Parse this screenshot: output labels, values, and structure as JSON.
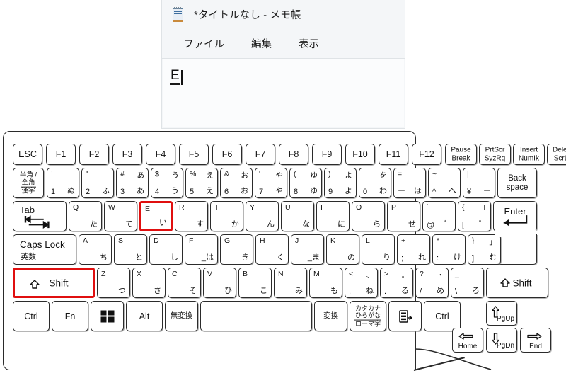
{
  "notepad": {
    "title": "*タイトルなし - メモ帳",
    "icon": "notepad-icon",
    "menus": [
      "ファイル",
      "編集",
      "表示"
    ],
    "document": {
      "composed_text": "E",
      "has_ime_underline": true,
      "caret_visible": true
    }
  },
  "keyboard": {
    "layout": "JIS Japanese 106-key (laptop)",
    "highlight_color": "#e00f0f",
    "highlighted_keys": [
      "E",
      "Shift-left"
    ],
    "rows": {
      "function_row": [
        {
          "name": "escape",
          "label": "ESC"
        },
        {
          "name": "f1",
          "label": "F1"
        },
        {
          "name": "f2",
          "label": "F2"
        },
        {
          "name": "f3",
          "label": "F3"
        },
        {
          "name": "f4",
          "label": "F4"
        },
        {
          "name": "f5",
          "label": "F5"
        },
        {
          "name": "f6",
          "label": "F6"
        },
        {
          "name": "f7",
          "label": "F7"
        },
        {
          "name": "f8",
          "label": "F8"
        },
        {
          "name": "f9",
          "label": "F9"
        },
        {
          "name": "f10",
          "label": "F10"
        },
        {
          "name": "f11",
          "label": "F11"
        },
        {
          "name": "f12",
          "label": "F12"
        },
        {
          "name": "pause-break",
          "line1": "Pause",
          "line2": "Break"
        },
        {
          "name": "print-screen",
          "line1": "PrtScr",
          "line2": "SyzRq"
        },
        {
          "name": "insert-numlk",
          "line1": "Insert",
          "line2": "NumIk"
        },
        {
          "name": "delete-scrlk",
          "line1": "Delete",
          "line2": "ScrLk"
        }
      ],
      "number_row": [
        {
          "name": "hankaku-zenkaku",
          "l1": "半角 /",
          "l2": "全角",
          "l3": "漢字"
        },
        {
          "name": "digit-1",
          "tl": "!",
          "bl": "1",
          "br": "ぬ"
        },
        {
          "name": "digit-2",
          "tl": "\"",
          "bl": "2",
          "br": "ふ"
        },
        {
          "name": "digit-3",
          "tl": "#",
          "tr": "あ",
          "bl": "3",
          "br": "あ"
        },
        {
          "name": "digit-4",
          "tl": "$",
          "tr": "う",
          "bl": "4",
          "br": "う"
        },
        {
          "name": "digit-5",
          "tl": "%",
          "tr": "え",
          "bl": "5",
          "br": "え"
        },
        {
          "name": "digit-6",
          "tl": "&",
          "tr": "お",
          "bl": "6",
          "br": "お"
        },
        {
          "name": "digit-7",
          "tl": "'",
          "tr": "や",
          "bl": "7",
          "br": "や"
        },
        {
          "name": "digit-8",
          "tl": "(",
          "tr": "ゆ",
          "bl": "8",
          "br": "ゆ"
        },
        {
          "name": "digit-9",
          "tl": ")",
          "tr": "よ",
          "bl": "9",
          "br": "よ"
        },
        {
          "name": "digit-0",
          "tr": "を",
          "bl": "0",
          "br": "わ"
        },
        {
          "name": "minus",
          "tl": "=",
          "bl": "ー",
          "br": "ほ"
        },
        {
          "name": "caret",
          "tl": "~",
          "bl": "^",
          "br": "へ"
        },
        {
          "name": "yen",
          "tl": "|",
          "bl": "¥",
          "br": "ー"
        },
        {
          "name": "backspace",
          "line1": "Back",
          "line2": "space"
        }
      ],
      "qwerty_row": [
        {
          "name": "tab",
          "label": "Tab",
          "icon": "tab-arrows-icon"
        },
        {
          "name": "q",
          "tl": "Q",
          "br": "た"
        },
        {
          "name": "w",
          "tl": "W",
          "br": "て"
        },
        {
          "name": "e",
          "tl": "E",
          "br": "い",
          "highlighted": true
        },
        {
          "name": "r",
          "tl": "R",
          "br": "す"
        },
        {
          "name": "t",
          "tl": "T",
          "br": "か"
        },
        {
          "name": "y",
          "tl": "Y",
          "br": "ん"
        },
        {
          "name": "u",
          "tl": "U",
          "br": "な"
        },
        {
          "name": "i",
          "tl": "I",
          "br": "に"
        },
        {
          "name": "o",
          "tl": "O",
          "br": "ら"
        },
        {
          "name": "p",
          "tl": "P",
          "br": "せ"
        },
        {
          "name": "at",
          "tl": "`",
          "bl": "@",
          "br": "゛"
        },
        {
          "name": "bracket-left",
          "tl": "{",
          "tr": "「",
          "bl": "[",
          "br": "゜"
        },
        {
          "name": "enter",
          "label": "Enter",
          "icon": "enter-arrow-icon"
        }
      ],
      "home_row": [
        {
          "name": "caps-lock",
          "l1": "Caps Lock",
          "l2": "英数"
        },
        {
          "name": "a",
          "tl": "A",
          "br": "ち"
        },
        {
          "name": "s",
          "tl": "S",
          "br": "と"
        },
        {
          "name": "d",
          "tl": "D",
          "br": "し"
        },
        {
          "name": "f",
          "tl": "F",
          "br": "_は"
        },
        {
          "name": "g",
          "tl": "G",
          "br": "き"
        },
        {
          "name": "h",
          "tl": "H",
          "br": "く"
        },
        {
          "name": "j",
          "tl": "J",
          "br": "_ま"
        },
        {
          "name": "k",
          "tl": "K",
          "br": "の"
        },
        {
          "name": "l",
          "tl": "L",
          "br": "り"
        },
        {
          "name": "semicolon",
          "tl": "+",
          "bl": ";",
          "br": "れ"
        },
        {
          "name": "colon",
          "tl": "*",
          "bl": ":",
          "br": "け"
        },
        {
          "name": "bracket-right",
          "tl": "}",
          "tr": "」",
          "bl": "]",
          "br": "む"
        },
        {
          "name": "enter-lower",
          "label": ""
        }
      ],
      "shift_row": [
        {
          "name": "shift-left",
          "label": "Shift",
          "icon": "shift-arrow-icon",
          "highlighted": true
        },
        {
          "name": "z",
          "tl": "Z",
          "br": "つ"
        },
        {
          "name": "x",
          "tl": "X",
          "br": "さ"
        },
        {
          "name": "c",
          "tl": "C",
          "br": "そ"
        },
        {
          "name": "v",
          "tl": "V",
          "br": "ひ"
        },
        {
          "name": "b",
          "tl": "B",
          "br": "こ"
        },
        {
          "name": "n",
          "tl": "N",
          "br": "み"
        },
        {
          "name": "m",
          "tl": "M",
          "br": "も"
        },
        {
          "name": "comma",
          "tl": "<",
          "tr": "、",
          "bl": ",",
          "br": "ね"
        },
        {
          "name": "period",
          "tl": ">",
          "tr": "。",
          "bl": ".",
          "br": "る"
        },
        {
          "name": "slash",
          "tl": "?",
          "tr": "・",
          "bl": "/",
          "br": "め"
        },
        {
          "name": "backslash",
          "tl": "_",
          "bl": "\\",
          "br": "ろ"
        },
        {
          "name": "shift-right",
          "label": "Shift",
          "icon": "shift-arrow-icon"
        }
      ],
      "bottom_row": [
        {
          "name": "ctrl-left",
          "label": "Ctrl"
        },
        {
          "name": "fn",
          "label": "Fn"
        },
        {
          "name": "windows",
          "label": "",
          "icon": "windows-logo-icon"
        },
        {
          "name": "alt-left",
          "label": "Alt"
        },
        {
          "name": "muhenkan",
          "label": "無変換"
        },
        {
          "name": "space",
          "label": ""
        },
        {
          "name": "henkan",
          "label": "変換"
        },
        {
          "name": "katakana-hiragana",
          "l1": "カタカナ",
          "l2": "ひらがな",
          "l3": "ローマ字"
        },
        {
          "name": "ime-toggle",
          "label": "",
          "icon": "ime-mode-icon"
        },
        {
          "name": "ctrl-right",
          "label": "Ctrl"
        }
      ],
      "arrow_cluster": [
        {
          "name": "arrow-up-pgup",
          "label": "PgUp",
          "icon": "arrow-up-icon"
        },
        {
          "name": "arrow-left-home",
          "label": "Home",
          "icon": "arrow-left-icon"
        },
        {
          "name": "arrow-down-pgdn",
          "label": "PgDn",
          "icon": "arrow-down-icon"
        },
        {
          "name": "arrow-right-end",
          "label": "End",
          "icon": "arrow-right-icon"
        }
      ]
    }
  }
}
